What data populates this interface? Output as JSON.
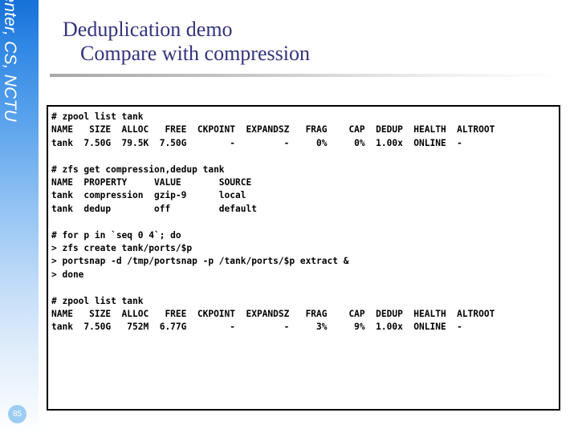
{
  "slide": {
    "sidebar_label": "Computer Center, CS, NCTU",
    "page_number": "85",
    "title_line1": "Deduplication demo",
    "title_line2": "Compare with compression",
    "colors": {
      "title": "#33337f",
      "sidebar_top": "#1570d8",
      "sidebar_bottom": "#ffffff",
      "badge": "#9ccdf2",
      "terminal_border": "#000000",
      "terminal_text": "#000000"
    }
  },
  "terminal": {
    "blocks": [
      {
        "name": "zpool-list-before",
        "lines": [
          "# zpool list tank",
          "NAME   SIZE  ALLOC   FREE  CKPOINT  EXPANDSZ   FRAG    CAP  DEDUP  HEALTH  ALTROOT",
          "tank  7.50G  79.5K  7.50G        -         -     0%     0%  1.00x  ONLINE  -"
        ]
      },
      {
        "name": "zfs-get-properties",
        "lines": [
          "# zfs get compression,dedup tank",
          "NAME  PROPERTY     VALUE       SOURCE",
          "tank  compression  gzip-9      local",
          "tank  dedup        off         default"
        ]
      },
      {
        "name": "for-loop-extract-ports",
        "lines": [
          "# for p in `seq 0 4`; do",
          "> zfs create tank/ports/$p",
          "> portsnap -d /tmp/portsnap -p /tank/ports/$p extract &",
          "> done"
        ]
      },
      {
        "name": "zpool-list-after",
        "lines": [
          "# zpool list tank",
          "NAME   SIZE  ALLOC   FREE  CKPOINT  EXPANDSZ   FRAG    CAP  DEDUP  HEALTH  ALTROOT",
          "tank  7.50G   752M  6.77G        -         -     3%     9%  1.00x  ONLINE  -"
        ]
      }
    ]
  }
}
